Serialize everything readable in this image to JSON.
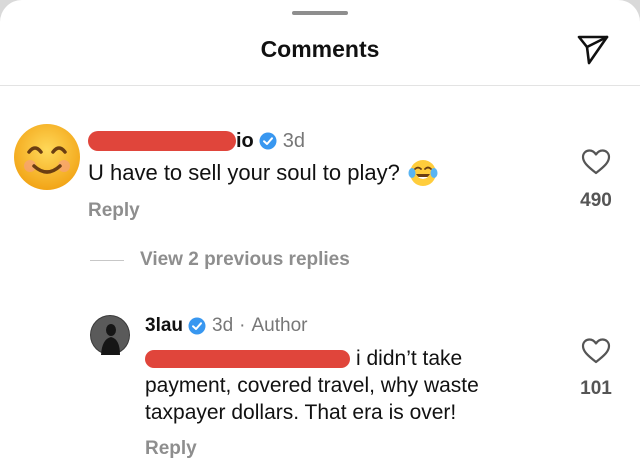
{
  "header": {
    "title": "Comments"
  },
  "comment": {
    "username_visible": "io",
    "verified": true,
    "time": "3d",
    "text": "U have to sell your soul to play?",
    "emoji": "face-with-tears-of-joy",
    "reply_label": "Reply",
    "likes": "490"
  },
  "thread": {
    "view_replies_label": "View 2 previous replies"
  },
  "reply": {
    "username": "3lau",
    "verified": true,
    "time": "3d",
    "separator": "·",
    "author_badge": "Author",
    "text_line1": "i didn’t take",
    "text_rest": "payment, covered travel, why waste taxpayer dollars. That era is over!",
    "reply_label": "Reply",
    "likes": "101"
  },
  "colors": {
    "redaction": "#e0453b",
    "verified_blue": "#3897f0",
    "muted": "#8e8e8e"
  }
}
